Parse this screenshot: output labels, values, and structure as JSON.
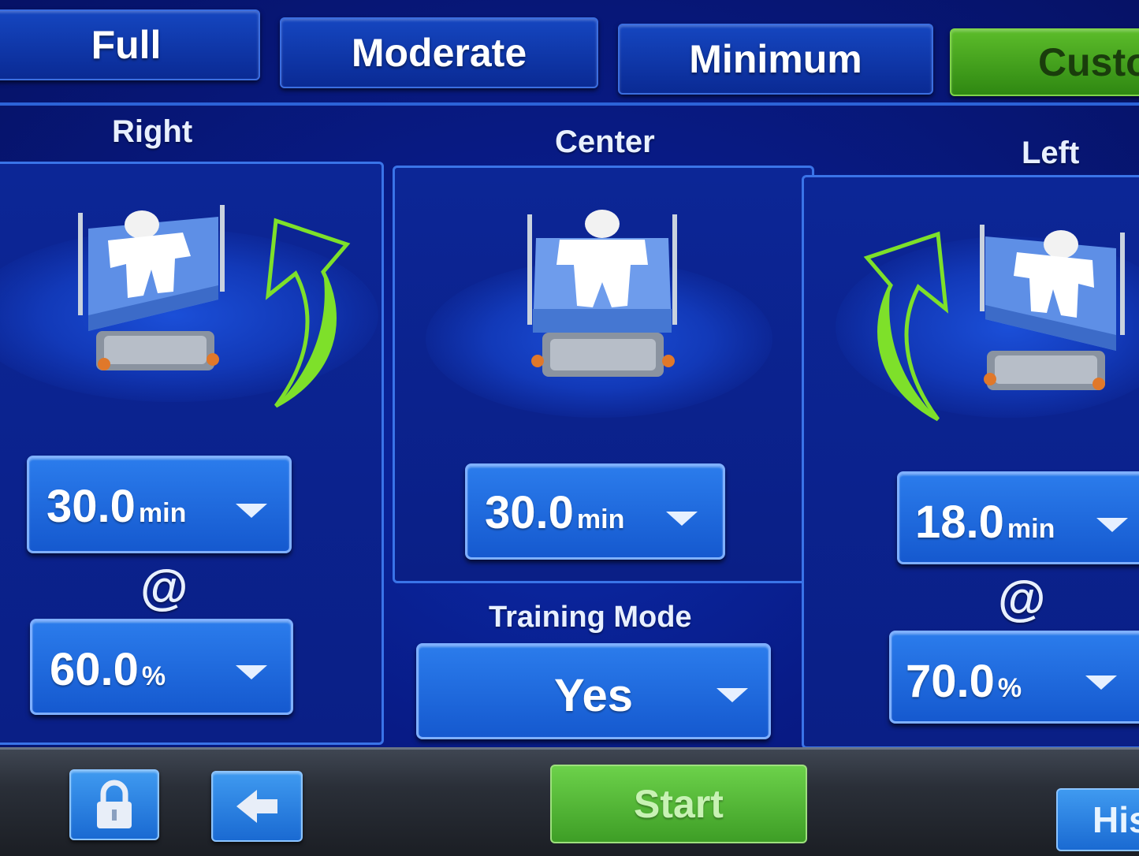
{
  "tabs": [
    {
      "label": "Full"
    },
    {
      "label": "Moderate"
    },
    {
      "label": "Minimum"
    },
    {
      "label": "Custo",
      "active": true
    }
  ],
  "columns": {
    "right": {
      "label": "Right",
      "duration": {
        "value": "30.0",
        "unit": "min"
      },
      "at_symbol": "@",
      "angle": {
        "value": "60.0",
        "unit": "%"
      }
    },
    "center": {
      "label": "Center",
      "duration": {
        "value": "30.0",
        "unit": "min"
      },
      "training_mode": {
        "label": "Training Mode",
        "value": "Yes"
      }
    },
    "left": {
      "label": "Left",
      "duration": {
        "value": "18.0",
        "unit": "min"
      },
      "at_symbol": "@",
      "angle": {
        "value": "70.0",
        "unit": "%"
      }
    }
  },
  "bottom_bar": {
    "lock_icon": "lock-icon",
    "back_icon": "back-arrow-icon",
    "start_label": "Start",
    "history_label": "His"
  },
  "colors": {
    "background": "#081b86",
    "tab_blue": "#1546c0",
    "active_green": "#5cbc2a",
    "arrow_green": "#7ee02a",
    "dropdown_blue": "#1f6ae0"
  }
}
